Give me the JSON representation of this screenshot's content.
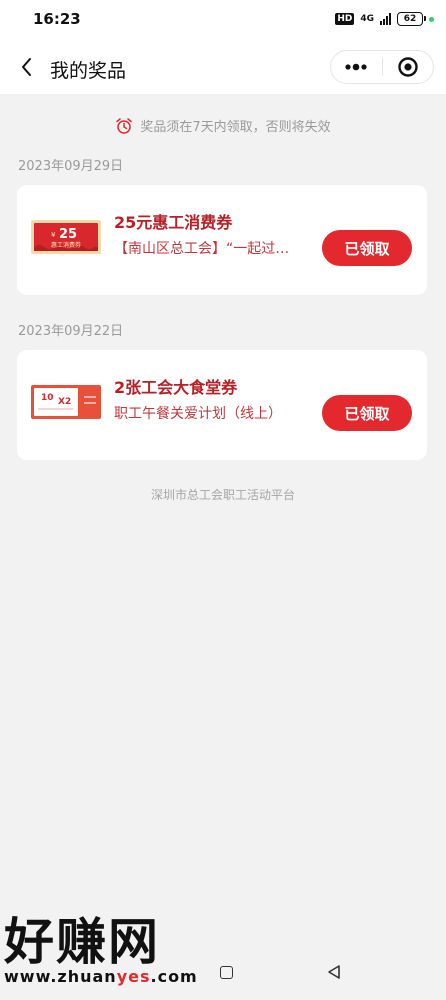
{
  "status_bar": {
    "time": "16:23",
    "hd_label": "HD",
    "network_label": "4G",
    "battery_level": "62",
    "dot_color": "#2ecc71"
  },
  "nav": {
    "title": "我的奖品"
  },
  "notice": {
    "text": "奖品须在7天内领取，否则将失效",
    "icon": "alarm-clock-icon"
  },
  "prizes": [
    {
      "date": "2023年09月29日",
      "title": "25元惠工消费券",
      "subtitle": "【南山区总工会】“一起过…",
      "button": "已领取",
      "thumb": {
        "amount": "25",
        "label": "惠工消费券",
        "currency": "¥"
      }
    },
    {
      "date": "2023年09月22日",
      "title": "2张工会大食堂券",
      "subtitle": "职工午餐关爱计划（线上）",
      "button": "已领取",
      "thumb": {
        "amount": "10",
        "multiplier": "X2"
      }
    }
  ],
  "footer": {
    "text": "深圳市总工会职工活动平台"
  },
  "watermark": {
    "title": "好赚网",
    "url_prefix": "www.zhuan",
    "url_highlight": "yes",
    "url_suffix": ".com"
  },
  "colors": {
    "accent": "#e3282e",
    "title_red": "#b82025",
    "background": "#f2f2f2"
  }
}
